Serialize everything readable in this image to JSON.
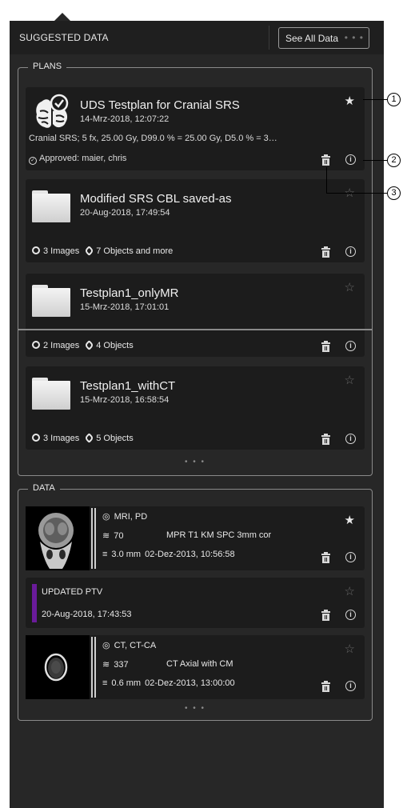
{
  "header": {
    "title": "SUGGESTED DATA",
    "see_all_label": "See All Data",
    "more_dots": "• • •"
  },
  "plans": {
    "legend": "PLANS",
    "more_dots": "• • •",
    "items": [
      {
        "title": "UDS Testplan for Cranial SRS",
        "date": "14-Mrz-2018, 12:07:22",
        "description": "Cranial SRS; 5 fx, 25.00 Gy, D99.0 % = 25.00 Gy, D5.0 % = 3…",
        "approved": "Approved:  maier, chris",
        "starred": true
      },
      {
        "title": "Modified SRS CBL saved-as",
        "date": "20-Aug-2018, 17:49:54",
        "images": "3 Images",
        "objects": "7 Objects and more",
        "starred": false
      },
      {
        "title": "Testplan1_onlyMR",
        "date": "15-Mrz-2018, 17:01:01",
        "images": "2 Images",
        "objects": "4 Objects",
        "starred": false
      },
      {
        "title": "Testplan1_withCT",
        "date": "15-Mrz-2018, 16:58:54",
        "images": "3 Images",
        "objects": "5 Objects",
        "starred": false
      }
    ]
  },
  "data": {
    "legend": "DATA",
    "more_dots": "• • •",
    "items": [
      {
        "modality": "MRI, PD",
        "slices": "70",
        "series": "MPR T1 KM SPC 3mm cor",
        "thickness": "3.0 mm",
        "date": "02-Dez-2013, 10:56:58",
        "starred": true
      },
      {
        "title": "UPDATED PTV",
        "date": "20-Aug-2018, 17:43:53",
        "color": "#6a1b9a",
        "starred": false
      },
      {
        "modality": "CT, CT-CA",
        "slices": "337",
        "series": "CT Axial with CM",
        "thickness": "0.6 mm",
        "date": "02-Dez-2013, 13:00:00",
        "starred": false
      }
    ]
  },
  "callouts": [
    "1",
    "2",
    "3"
  ],
  "icons": {
    "star_filled": "★",
    "star_empty": "☆",
    "info": "i"
  }
}
